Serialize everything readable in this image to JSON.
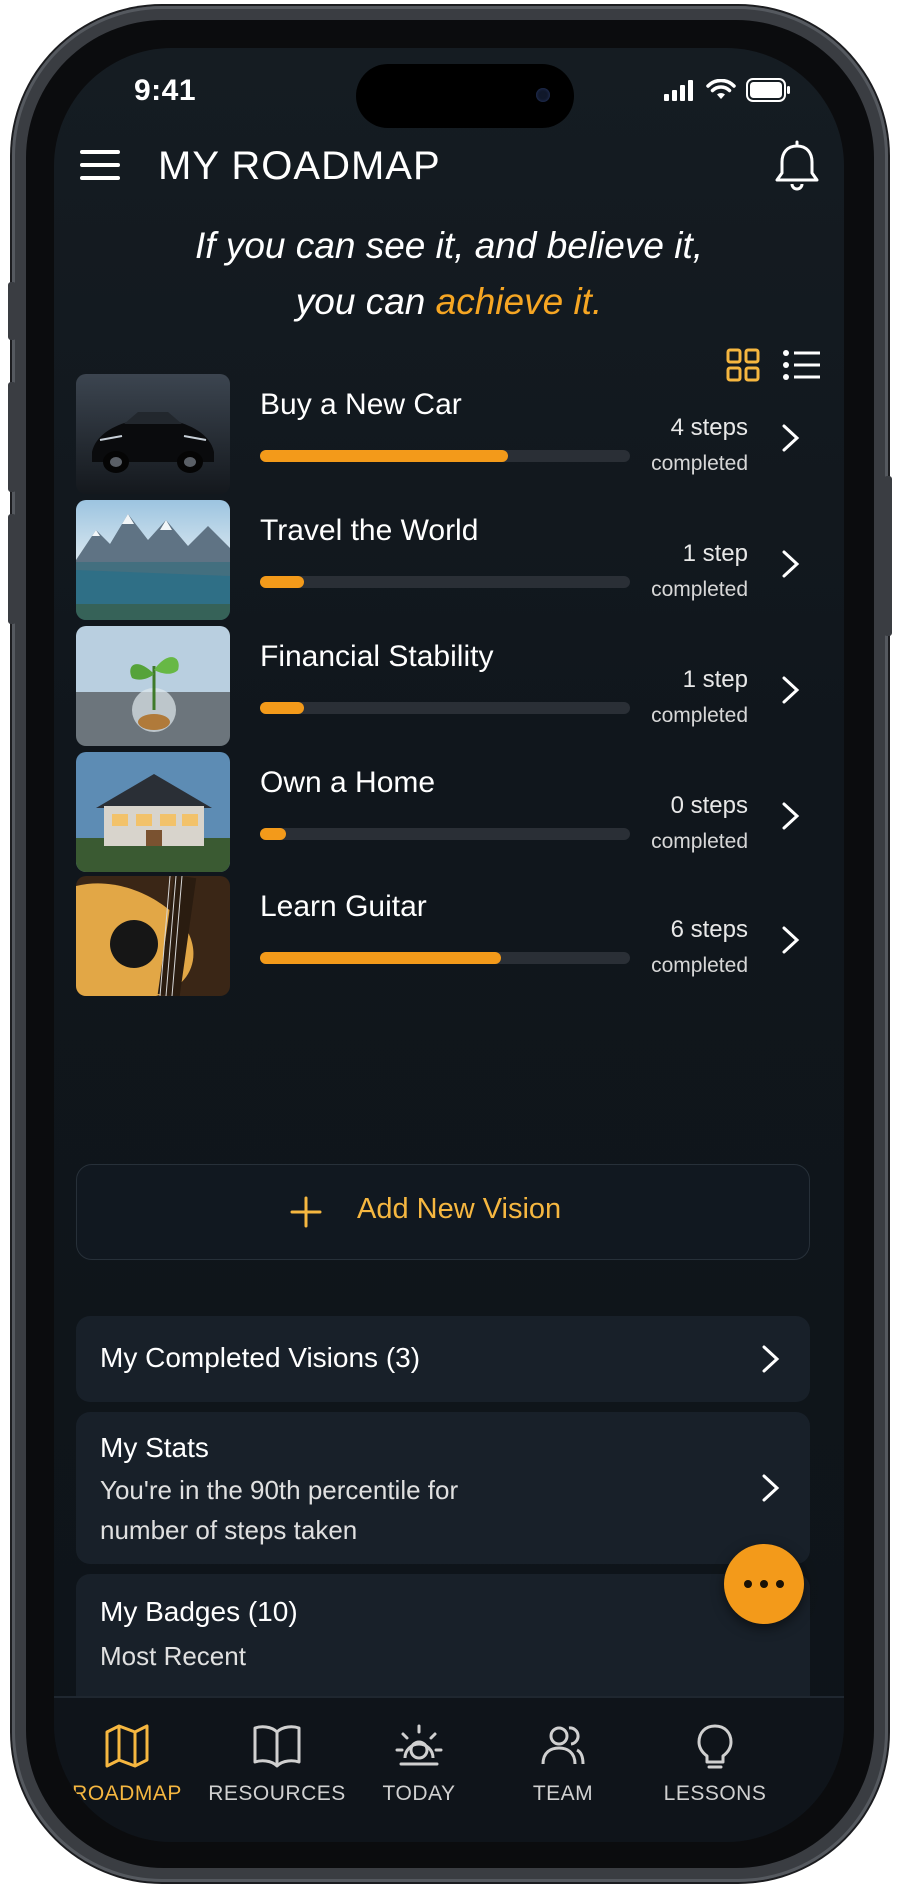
{
  "status_bar": {
    "time": "9:41"
  },
  "header": {
    "title": "MY ROADMAP"
  },
  "quote": {
    "line1": "If you can see it, and believe it,",
    "line2_prefix": "you can ",
    "line2_highlight": "achieve it."
  },
  "visions": [
    {
      "name": "Buy a New Car",
      "count": "4 steps",
      "status": "completed",
      "progress": 0.67,
      "image": "car"
    },
    {
      "name": "Travel the World",
      "count": "1 step",
      "status": "completed",
      "progress": 0.12,
      "image": "mountains-lake"
    },
    {
      "name": "Financial Stability",
      "count": "1 step",
      "status": "completed",
      "progress": 0.12,
      "image": "plant-coins"
    },
    {
      "name": "Own a Home",
      "count": "0 steps",
      "status": "completed",
      "progress": 0.07,
      "image": "house"
    },
    {
      "name": "Learn Guitar",
      "count": "6 steps",
      "status": "completed",
      "progress": 0.65,
      "image": "guitar"
    }
  ],
  "add_vision": {
    "label": "Add New Vision"
  },
  "completed_visions": {
    "label": "My Completed Visions (3)"
  },
  "stats": {
    "title": "My Stats",
    "line1": "You're in the 90th percentile for",
    "line2": "number of steps taken"
  },
  "badges": {
    "title": "My Badges (10)",
    "subtitle": "Most Recent"
  },
  "tabs": [
    {
      "label": "ROADMAP",
      "icon": "map-icon",
      "active": true
    },
    {
      "label": "RESOURCES",
      "icon": "book-icon",
      "active": false
    },
    {
      "label": "TODAY",
      "icon": "sun-icon",
      "active": false
    },
    {
      "label": "TEAM",
      "icon": "team-icon",
      "active": false
    },
    {
      "label": "LESSONS",
      "icon": "lightbulb-icon",
      "active": false
    }
  ],
  "colors": {
    "accent": "#f39a1a",
    "background": "#121920",
    "card": "#182029",
    "text": "#ffffff"
  }
}
